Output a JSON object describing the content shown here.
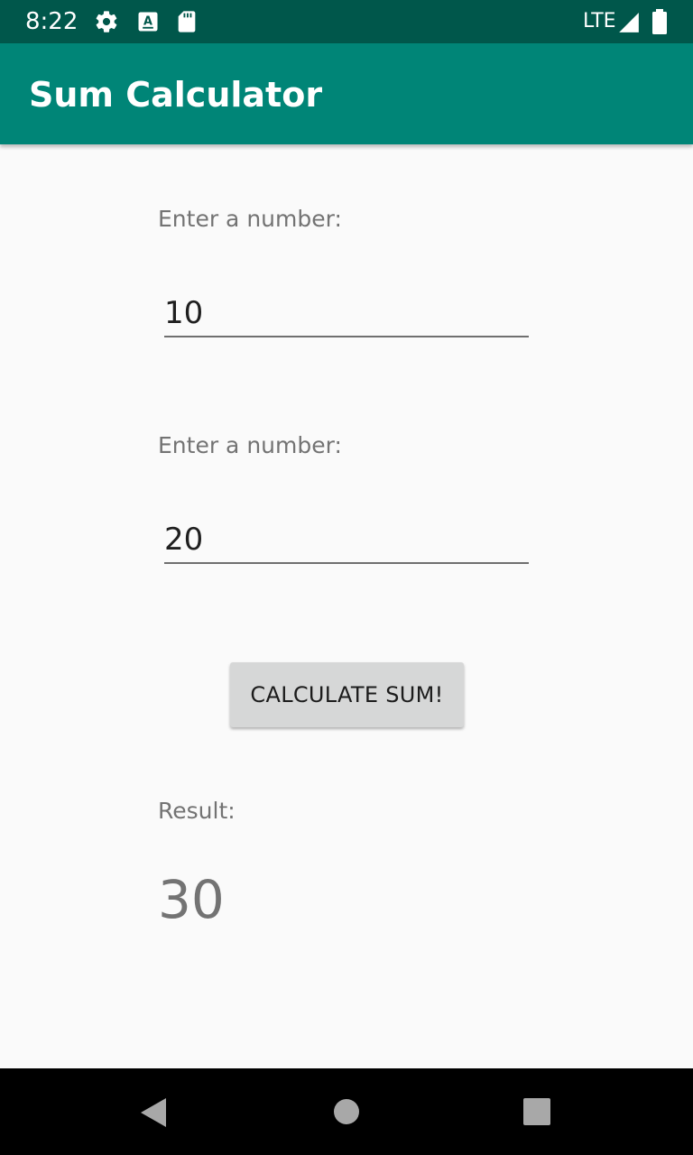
{
  "status_bar": {
    "time": "8:22",
    "network": "LTE",
    "icons": [
      "gear-icon",
      "a-keyboard-icon",
      "sd-card-icon",
      "signal-icon",
      "battery-icon"
    ],
    "background": "#00574b"
  },
  "app_bar": {
    "title": "Sum Calculator",
    "background": "#008577"
  },
  "form": {
    "first": {
      "label": "Enter a number:",
      "value": "10"
    },
    "second": {
      "label": "Enter a number:",
      "value": "20"
    },
    "button_label": "CALCULATE SUM!",
    "result_label": "Result:",
    "result_value": "30"
  },
  "nav_bar": {
    "icons": [
      "back-icon",
      "home-icon",
      "recents-icon"
    ]
  }
}
